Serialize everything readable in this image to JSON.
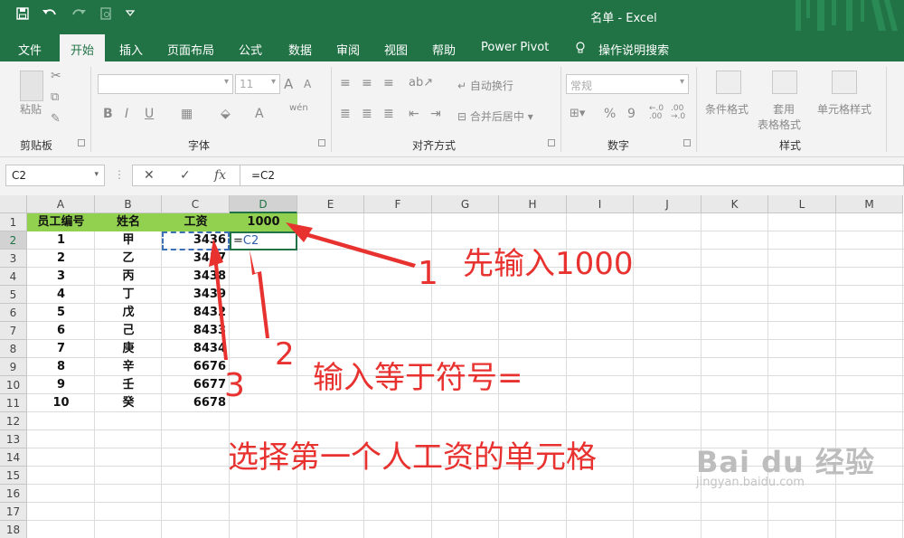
{
  "window": {
    "title": "名单 - Excel"
  },
  "colors": {
    "accent": "#217346",
    "header_fill": "#92d050",
    "annotation": "#e8322f",
    "reference": "#2e5fa8"
  },
  "quick_access": {
    "icons": [
      "save-icon",
      "undo-icon",
      "redo-icon",
      "print-preview-icon",
      "customize-icon"
    ]
  },
  "tabs": [
    "文件",
    "开始",
    "插入",
    "页面布局",
    "公式",
    "数据",
    "审阅",
    "视图",
    "帮助",
    "Power Pivot",
    "操作说明搜索"
  ],
  "ribbon": {
    "clipboard": {
      "label": "剪贴板",
      "paste": "粘贴"
    },
    "font": {
      "label": "字体",
      "size": "11",
      "grow": "A",
      "shrink": "A",
      "bold": "B",
      "italic": "I",
      "underline": "U",
      "color": "A",
      "phonetic": "wén"
    },
    "alignment": {
      "label": "对齐方式",
      "wrap": "自动换行",
      "merge": "合并后居中"
    },
    "number": {
      "label": "数字",
      "format": "常规",
      "percent": "%",
      "comma": "9"
    },
    "styles": {
      "label": "样式",
      "conditional": "条件格式",
      "table_line1": "套用",
      "table_line2": "表格格式",
      "cell": "单元格样式"
    }
  },
  "formula_bar": {
    "name_box": "C2",
    "formula": "=C2",
    "cancel": "✕",
    "enter": "✓",
    "fx": "fx"
  },
  "columns": [
    "A",
    "B",
    "C",
    "D",
    "E",
    "F",
    "G",
    "H",
    "I",
    "J",
    "K",
    "L",
    "M"
  ],
  "rows": [
    "1",
    "2",
    "3",
    "4",
    "5",
    "6",
    "7",
    "8",
    "9",
    "10",
    "11",
    "12",
    "13",
    "14",
    "15",
    "16",
    "17",
    "18"
  ],
  "sheet": {
    "header": {
      "a": "员工编号",
      "b": "姓名",
      "c": "工资",
      "d": "1000"
    },
    "records": [
      {
        "a": "1",
        "b": "甲",
        "c": "3436"
      },
      {
        "a": "2",
        "b": "乙",
        "c": "3437"
      },
      {
        "a": "3",
        "b": "丙",
        "c": "3438"
      },
      {
        "a": "4",
        "b": "丁",
        "c": "3439"
      },
      {
        "a": "5",
        "b": "戊",
        "c": "8432"
      },
      {
        "a": "6",
        "b": "己",
        "c": "8433"
      },
      {
        "a": "7",
        "b": "庚",
        "c": "8434"
      },
      {
        "a": "8",
        "b": "辛",
        "c": "6676"
      },
      {
        "a": "9",
        "b": "壬",
        "c": "6677"
      },
      {
        "a": "10",
        "b": "癸",
        "c": "6678"
      }
    ],
    "active_cell": {
      "eq": "=",
      "ref": "C2"
    }
  },
  "annotations": {
    "step1_num": "1",
    "step1_text": "先输入1000",
    "step2_num": "2",
    "step2_text": "输入等于符号=",
    "step3_num": "3",
    "step3_text": "选择第一个人工资的单元格"
  },
  "watermark": {
    "main": "Bai du 经验",
    "sub": "jingyan.baidu.com"
  }
}
